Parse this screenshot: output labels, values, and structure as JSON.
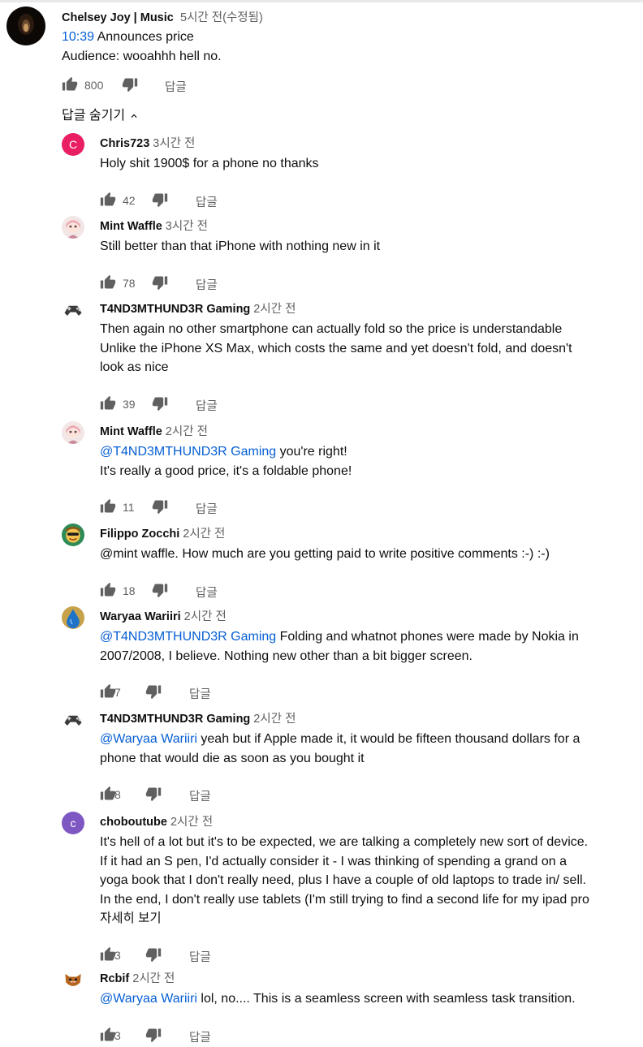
{
  "top_comment": {
    "author": "Chelsey Joy | Music",
    "time": "5시간 전(수정됨)",
    "timestamp_link": "10:39",
    "line1_rest": " Announces price",
    "line2": "Audience: wooahhh hell no.",
    "likes": "800",
    "reply_label": "답글"
  },
  "hide_replies_label": "답글 숨기기",
  "replies": [
    {
      "author": "Chris723",
      "time": "3시간 전",
      "avatar": {
        "type": "letter",
        "letter": "C",
        "color": "#e91e63"
      },
      "lines": [
        {
          "text": "Holy shit 1900$ for a phone no thanks"
        }
      ],
      "likes": "42",
      "reply_label": "답글"
    },
    {
      "author": "Mint Waffle",
      "time": "3시간 전",
      "avatar": {
        "type": "image",
        "icon": "anime-girl-avatar"
      },
      "lines": [
        {
          "text": "Still better than that iPhone with nothing new in it"
        }
      ],
      "likes": "78",
      "reply_label": "답글"
    },
    {
      "author": "T4ND3MTHUND3R Gaming",
      "time": "2시간 전",
      "avatar": {
        "type": "image",
        "icon": "game-controller-avatar"
      },
      "lines": [
        {
          "text": "Then again no other smartphone can actually fold so the price is understandable"
        },
        {
          "text": "Unlike the iPhone XS Max, which costs the same and yet doesn't fold, and doesn't"
        },
        {
          "text": "look as nice"
        }
      ],
      "likes": "39",
      "reply_label": "답글"
    },
    {
      "author": "Mint Waffle",
      "time": "2시간 전",
      "avatar": {
        "type": "image",
        "icon": "anime-girl-avatar"
      },
      "lines": [
        {
          "mention": "@T4ND3MTHUND3R Gaming",
          "text": " you're right!"
        },
        {
          "text": "It's really a good price, it's a foldable phone!"
        }
      ],
      "likes": "11",
      "reply_label": "답글"
    },
    {
      "author": "Filippo Zocchi",
      "time": "2시간 전",
      "avatar": {
        "type": "image",
        "icon": "cartoon-face-avatar"
      },
      "lines": [
        {
          "text": "@mint waffle. How much are you getting paid to write positive comments :-) :-)"
        }
      ],
      "likes": "18",
      "reply_label": "답글"
    },
    {
      "author": "Waryaa Wariiri",
      "time": "2시간 전",
      "avatar": {
        "type": "image",
        "icon": "water-drop-avatar"
      },
      "lines": [
        {
          "mention": "@T4ND3MTHUND3R Gaming",
          "text": " Folding and whatnot phones were made by Nokia in"
        },
        {
          "text": "2007/2008, I believe. Nothing new other than a bit bigger screen."
        }
      ],
      "likes": "7",
      "reply_label": "답글"
    },
    {
      "author": "T4ND3MTHUND3R Gaming",
      "time": "2시간 전",
      "avatar": {
        "type": "image",
        "icon": "game-controller-avatar"
      },
      "lines": [
        {
          "mention": "@Waryaa Wariiri",
          "text": " yeah but if Apple made it, it would be fifteen thousand dollars for a"
        },
        {
          "text": "phone that would die as soon as you bought it"
        }
      ],
      "likes": "8",
      "reply_label": "답글"
    },
    {
      "author": "choboutube",
      "time": "2시간 전",
      "avatar": {
        "type": "letter",
        "letter": "c",
        "color": "#7e57c2"
      },
      "lines": [
        {
          "text": "It's hell of a lot but it's to be expected, we are talking a completely new sort of device."
        },
        {
          "text": "If it had an S pen, I'd actually consider it - I was thinking of spending a grand on a"
        },
        {
          "text": "yoga book that I don't really need, plus I have a couple of old laptops to trade in/ sell."
        },
        {
          "text": "In the end, I don't really use tablets (I'm still trying to find a second life for my ipad pro"
        }
      ],
      "read_more": "자세히 보기",
      "likes": "3",
      "reply_label": "답글"
    },
    {
      "author": "Rcbif",
      "time": "2시간 전",
      "avatar": {
        "type": "image",
        "icon": "cat-avatar"
      },
      "lines": [
        {
          "mention": "@Waryaa Wariiri",
          "text": " lol, no.... This is a seamless screen with seamless task transition."
        }
      ],
      "likes": "3",
      "reply_label": "답글"
    }
  ]
}
